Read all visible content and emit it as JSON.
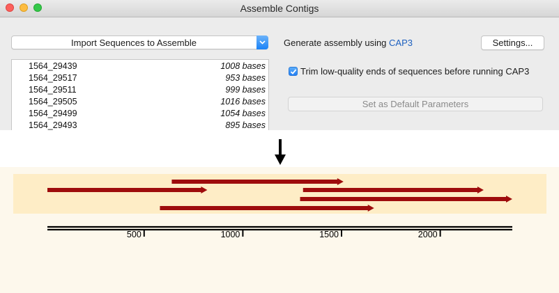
{
  "window": {
    "title": "Assemble Contigs"
  },
  "import": {
    "label": "Import Sequences to Assemble"
  },
  "sequences": [
    {
      "name": "1564_29439",
      "length": "1008 bases"
    },
    {
      "name": "1564_29517",
      "length": "953 bases"
    },
    {
      "name": "1564_29511",
      "length": "999 bases"
    },
    {
      "name": "1564_29505",
      "length": "1016 bases"
    },
    {
      "name": "1564_29499",
      "length": "1054 bases"
    },
    {
      "name": "1564_29493",
      "length": "895 bases"
    }
  ],
  "generate": {
    "prefix": "Generate assembly using ",
    "program": "CAP3"
  },
  "settings_label": "Settings...",
  "trim": {
    "checked": true,
    "label": "Trim low-quality ends of sequences before running CAP3"
  },
  "default_button": "Set as Default Parameters",
  "assembly": {
    "read_color": "#9e0c0c",
    "band_color": "#feedc6",
    "reads": [
      {
        "start": 640,
        "end": 1510
      },
      {
        "start": 10,
        "end": 820
      },
      {
        "start": 1305,
        "end": 2220
      },
      {
        "start": 1290,
        "end": 2365
      },
      {
        "start": 580,
        "end": 1665
      }
    ],
    "ruler": {
      "start": 10,
      "end": 2365,
      "ticks": [
        500,
        1000,
        1500,
        2000
      ],
      "tick_labels": [
        "500",
        "1000",
        "1500",
        "2000"
      ]
    }
  }
}
